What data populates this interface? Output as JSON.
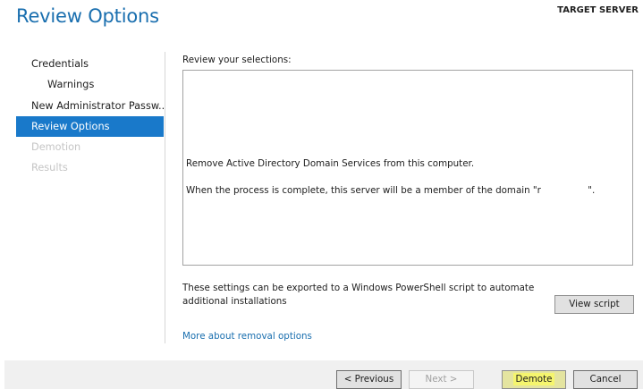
{
  "header": {
    "title": "Review Options",
    "target_server": "TARGET SERVER"
  },
  "nav": {
    "items": [
      {
        "label": "Credentials"
      },
      {
        "label": "Warnings"
      },
      {
        "label": "New Administrator Passw..."
      },
      {
        "label": "Review Options"
      },
      {
        "label": "Demotion"
      },
      {
        "label": "Results"
      }
    ]
  },
  "main": {
    "review_label": "Review your selections:",
    "review_lines": [
      "Remove Active Directory Domain Services from this computer.",
      "When the process is complete, this server will be a member of the domain \"r                \"."
    ],
    "export_text": "These settings can be exported to a Windows PowerShell script to automate additional installations",
    "view_script_label": "View script",
    "more_link": "More about removal options"
  },
  "footer": {
    "previous_label": "< Previous",
    "next_label": "Next >",
    "demote_label": "Demote",
    "cancel_label": "Cancel"
  },
  "colors": {
    "accent": "#1979ca",
    "title": "#1a6faf",
    "highlight": "#f5f56e"
  }
}
